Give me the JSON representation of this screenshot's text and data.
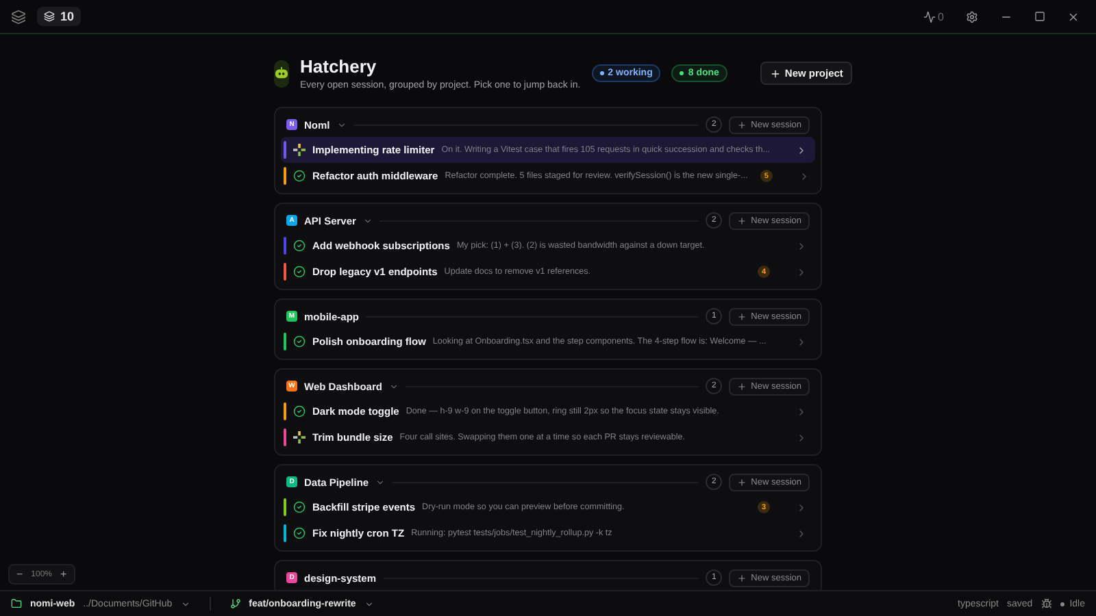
{
  "titlebar": {
    "session_count": "10",
    "activity_count": "0"
  },
  "header": {
    "title": "Hatchery",
    "subtitle": "Every open session, grouped by project. Pick one to jump back in.",
    "working": "2 working",
    "done": "8 done",
    "new_project": "New project"
  },
  "projects": [
    {
      "name": "Noml",
      "letter": "N",
      "color": "#7c5cf0",
      "count": "2",
      "collapsible": true,
      "new_session": "New session",
      "sessions": [
        {
          "title": "Implementing rate limiter",
          "detail": "On it. Writing a Vitest case that fires 105 requests in quick succession and checks th...",
          "color": "#6d5ce8",
          "working": true,
          "selected": true
        },
        {
          "title": "Refactor auth middleware",
          "detail": "Refactor complete. 5 files staged for review. verifySession() is the new single-...",
          "color": "#f59e0b",
          "working": false,
          "selected": false,
          "badge": "5"
        }
      ]
    },
    {
      "name": "API Server",
      "letter": "A",
      "color": "#0ea5e9",
      "count": "2",
      "collapsible": true,
      "new_session": "New session",
      "sessions": [
        {
          "title": "Add webhook subscriptions",
          "detail": "My pick: (1) + (3). (2) is wasted bandwidth against a down target.",
          "color": "#4f46e5",
          "working": false,
          "selected": false
        },
        {
          "title": "Drop legacy v1 endpoints",
          "detail": "Update docs to remove v1 references.",
          "color": "#ef5a3c",
          "working": false,
          "selected": false,
          "badge": "4"
        }
      ]
    },
    {
      "name": "mobile-app",
      "letter": "M",
      "color": "#22c55e",
      "count": "1",
      "collapsible": false,
      "new_session": "New session",
      "sessions": [
        {
          "title": "Polish onboarding flow",
          "detail": "Looking at Onboarding.tsx and the step components. The 4-step flow is: Welcome — ...",
          "color": "#22c55e",
          "working": false,
          "selected": false
        }
      ]
    },
    {
      "name": "Web Dashboard",
      "letter": "W",
      "color": "#f97316",
      "count": "2",
      "collapsible": true,
      "new_session": "New session",
      "sessions": [
        {
          "title": "Dark mode toggle",
          "detail": "Done — h-9 w-9 on the toggle button, ring still 2px so the focus state stays visible.",
          "color": "#f59e0b",
          "working": false,
          "selected": false
        },
        {
          "title": "Trim bundle size",
          "detail": "Four call sites. Swapping them one at a time so each PR stays reviewable.",
          "color": "#ec4899",
          "working": true,
          "selected": false
        }
      ]
    },
    {
      "name": "Data Pipeline",
      "letter": "D",
      "color": "#10b981",
      "count": "2",
      "collapsible": true,
      "new_session": "New session",
      "sessions": [
        {
          "title": "Backfill stripe events",
          "detail": "Dry-run mode so you can preview before committing.",
          "color": "#84cc16",
          "working": false,
          "selected": false,
          "badge": "3"
        },
        {
          "title": "Fix nightly cron TZ",
          "detail": "Running: pytest tests/jobs/test_nightly_rollup.py -k tz",
          "color": "#06b6d4",
          "working": false,
          "selected": false
        }
      ]
    },
    {
      "name": "design-system",
      "letter": "D",
      "color": "#ec4899",
      "count": "1",
      "collapsible": false,
      "new_session": "New session"
    }
  ],
  "zoom": {
    "minus": "−",
    "level": "100%",
    "plus": "+"
  },
  "status_bar": {
    "project": "nomi-web",
    "path": "../Documents/GitHub",
    "branch": "feat/onboarding-rewrite",
    "language": "typescript",
    "save_state": "saved",
    "state": "Idle"
  }
}
